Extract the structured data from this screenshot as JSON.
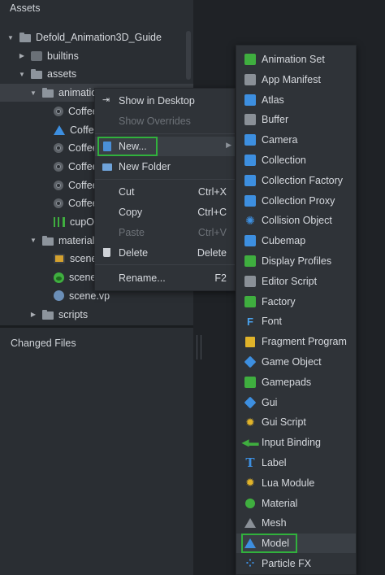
{
  "assets_pane": {
    "title": "Assets",
    "tree": [
      {
        "label": "Defold_Animation3D_Guide",
        "arrow": "▼",
        "icon": "folder-icon",
        "indent": 0,
        "selected": false
      },
      {
        "label": "builtins",
        "arrow": "▶",
        "icon": "puzzle-icon",
        "indent": 1,
        "selected": false
      },
      {
        "label": "assets",
        "arrow": "▼",
        "icon": "folder-icon",
        "indent": 1,
        "selected": false
      },
      {
        "label": "animatio",
        "arrow": "▼",
        "icon": "folder-icon",
        "indent": 2,
        "selected": true
      },
      {
        "label": "Coffee",
        "arrow": "",
        "icon": "coffee-icon",
        "indent": 3,
        "selected": false
      },
      {
        "label": "Coffee",
        "arrow": "",
        "icon": "model-icon",
        "indent": 3,
        "selected": false
      },
      {
        "label": "Coffee",
        "arrow": "",
        "icon": "coffee-icon",
        "indent": 3,
        "selected": false
      },
      {
        "label": "Coffee",
        "arrow": "",
        "icon": "coffee-icon",
        "indent": 3,
        "selected": false
      },
      {
        "label": "Coffee",
        "arrow": "",
        "icon": "coffee-icon",
        "indent": 3,
        "selected": false
      },
      {
        "label": "Coffee",
        "arrow": "",
        "icon": "coffee-icon",
        "indent": 3,
        "selected": false
      },
      {
        "label": "cupOc",
        "arrow": "",
        "icon": "animation-set-icon",
        "indent": 3,
        "selected": false
      },
      {
        "label": "material",
        "arrow": "▼",
        "icon": "folder-icon",
        "indent": 2,
        "selected": false
      },
      {
        "label": "scene.",
        "arrow": "",
        "icon": "material-icon",
        "indent": 3,
        "selected": false
      },
      {
        "label": "scene.",
        "arrow": "",
        "icon": "sphere-icon",
        "indent": 3,
        "selected": false
      },
      {
        "label": "scene.vp",
        "arrow": "",
        "icon": "vertex-program-icon",
        "indent": 3,
        "selected": false
      },
      {
        "label": "scripts",
        "arrow": "▶",
        "icon": "folder-icon",
        "indent": 2,
        "selected": false
      }
    ]
  },
  "changed_files": {
    "title": "Changed Files"
  },
  "context_menu": {
    "items": [
      {
        "label": "Show in Desktop",
        "shortcut": "",
        "icon": "show-in-desktop-icon",
        "disabled": false
      },
      {
        "label": "Show Overrides",
        "shortcut": "",
        "icon": "",
        "disabled": true
      },
      {
        "label": "New...",
        "shortcut": "",
        "icon": "new-file-icon",
        "disabled": false,
        "submenu": true
      },
      {
        "label": "New Folder",
        "shortcut": "",
        "icon": "new-folder-icon",
        "disabled": false
      },
      {
        "label": "Cut",
        "shortcut": "Ctrl+X",
        "icon": "",
        "disabled": false
      },
      {
        "label": "Copy",
        "shortcut": "Ctrl+C",
        "icon": "",
        "disabled": false
      },
      {
        "label": "Paste",
        "shortcut": "Ctrl+V",
        "icon": "",
        "disabled": true
      },
      {
        "label": "Delete",
        "shortcut": "Delete",
        "icon": "trash-icon",
        "disabled": false
      },
      {
        "label": "Rename...",
        "shortcut": "F2",
        "icon": "",
        "disabled": false
      }
    ]
  },
  "new_submenu": {
    "items": [
      {
        "label": "Animation Set",
        "icon": "animation-set-icon"
      },
      {
        "label": "App Manifest",
        "icon": "app-manifest-icon"
      },
      {
        "label": "Atlas",
        "icon": "atlas-icon"
      },
      {
        "label": "Buffer",
        "icon": "buffer-icon"
      },
      {
        "label": "Camera",
        "icon": "camera-icon"
      },
      {
        "label": "Collection",
        "icon": "collection-icon"
      },
      {
        "label": "Collection Factory",
        "icon": "collection-factory-icon"
      },
      {
        "label": "Collection Proxy",
        "icon": "collection-proxy-icon"
      },
      {
        "label": "Collision Object",
        "icon": "collision-object-icon"
      },
      {
        "label": "Cubemap",
        "icon": "cubemap-icon"
      },
      {
        "label": "Display Profiles",
        "icon": "display-profiles-icon"
      },
      {
        "label": "Editor Script",
        "icon": "editor-script-icon"
      },
      {
        "label": "Factory",
        "icon": "factory-icon"
      },
      {
        "label": "Font",
        "icon": "font-icon"
      },
      {
        "label": "Fragment Program",
        "icon": "fragment-program-icon"
      },
      {
        "label": "Game Object",
        "icon": "game-object-icon"
      },
      {
        "label": "Gamepads",
        "icon": "gamepads-icon"
      },
      {
        "label": "Gui",
        "icon": "gui-icon"
      },
      {
        "label": "Gui Script",
        "icon": "gui-script-icon"
      },
      {
        "label": "Input Binding",
        "icon": "input-binding-icon"
      },
      {
        "label": "Label",
        "icon": "label-icon"
      },
      {
        "label": "Lua Module",
        "icon": "lua-module-icon"
      },
      {
        "label": "Material",
        "icon": "material-icon"
      },
      {
        "label": "Mesh",
        "icon": "mesh-icon"
      },
      {
        "label": "Model",
        "icon": "model-icon"
      },
      {
        "label": "Particle FX",
        "icon": "particle-fx-icon"
      }
    ]
  },
  "colors": {
    "highlight_green": "#31b13d",
    "accent_blue": "#3d8fe0",
    "accent_green": "#3fae3f",
    "accent_yellow": "#e0b32a"
  }
}
